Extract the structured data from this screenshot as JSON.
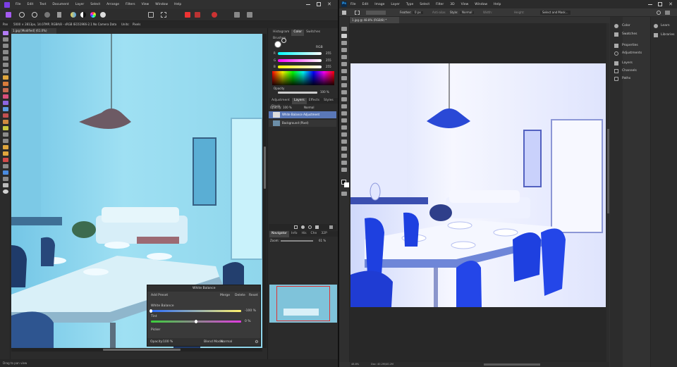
{
  "affinity": {
    "menu": [
      "File",
      "Edit",
      "Text",
      "Document",
      "Layer",
      "Select",
      "Arrange",
      "Filters",
      "View",
      "Window",
      "Help"
    ],
    "context": {
      "tool": "Pan",
      "info": "5000 × 2813px, 14.07MP, RGBA/8 - sRGB IEC61966-2.1",
      "camera": "No Camera Data",
      "units_label": "Units:",
      "units": "Pixels"
    },
    "doc_tab": "1.jpg [Modified] (61.0%)",
    "panel_tabs_top": [
      "Histogram",
      "Color",
      "Switches",
      "Brushes"
    ],
    "color": {
      "mode": "RGB",
      "r_label": "R",
      "g_label": "G",
      "b_label": "B",
      "r": "255",
      "g": "255",
      "b": "255",
      "opacity_label": "Opacity",
      "opacity": "100 %"
    },
    "panel_tabs_mid": [
      "Adjustment",
      "Layers",
      "Effects",
      "Styles",
      "Stock"
    ],
    "layers_bar": {
      "opacity_label": "Opacity:",
      "opacity": "100 %",
      "blend": "Normal"
    },
    "layers": [
      {
        "name": "White Balance Adjustment"
      },
      {
        "name": "Background (Pixel)"
      }
    ],
    "panel_tabs_nav": [
      "Navigator",
      "Info",
      "His",
      "Chn",
      "32P"
    ],
    "navigator": {
      "zoom_label": "Zoom:",
      "zoom": "61 %"
    },
    "wb_dialog": {
      "title": "White Balance",
      "add_preset": "Add Preset",
      "merge": "Merge",
      "delete": "Delete",
      "reset": "Reset",
      "wb_label": "White Balance",
      "wb_value": "-100 %",
      "tint_label": "Tint",
      "tint_value": "0 %",
      "picker": "Picker",
      "opacity_label": "Opacity:",
      "opacity": "100 %",
      "blend_label": "Blend Mode:",
      "blend": "Normal"
    },
    "status": "Drag to pan view"
  },
  "photoshop": {
    "logo": "Ps",
    "menu": [
      "File",
      "Edit",
      "Image",
      "Layer",
      "Type",
      "Select",
      "Filter",
      "3D",
      "View",
      "Window",
      "Help"
    ],
    "options": {
      "feather_label": "Feather:",
      "feather": "0 px",
      "antialias": "Anti-alias",
      "style_label": "Style:",
      "style": "Normal",
      "width_label": "Width:",
      "height_label": "Height:",
      "select_mask": "Select and Mask..."
    },
    "doc_tab": "1.jpg @ 48.8% (RGB/8) *",
    "status_zoom": "48.8%",
    "status_doc": "Doc: 40.2M/40.2M",
    "right_group1": [
      "Color",
      "Swatches"
    ],
    "right_group2": [
      "Properties",
      "Adjustments"
    ],
    "right_group3": [
      "Layers",
      "Channels",
      "Paths"
    ],
    "right_group4": [
      "Learn",
      "Libraries"
    ]
  },
  "colors": {
    "affinity_accent": "#7b3fe4",
    "ps_blue": "#31a8ff",
    "cyan_photo": "#8fd8ef",
    "blue_photo": "#2f55e0"
  }
}
